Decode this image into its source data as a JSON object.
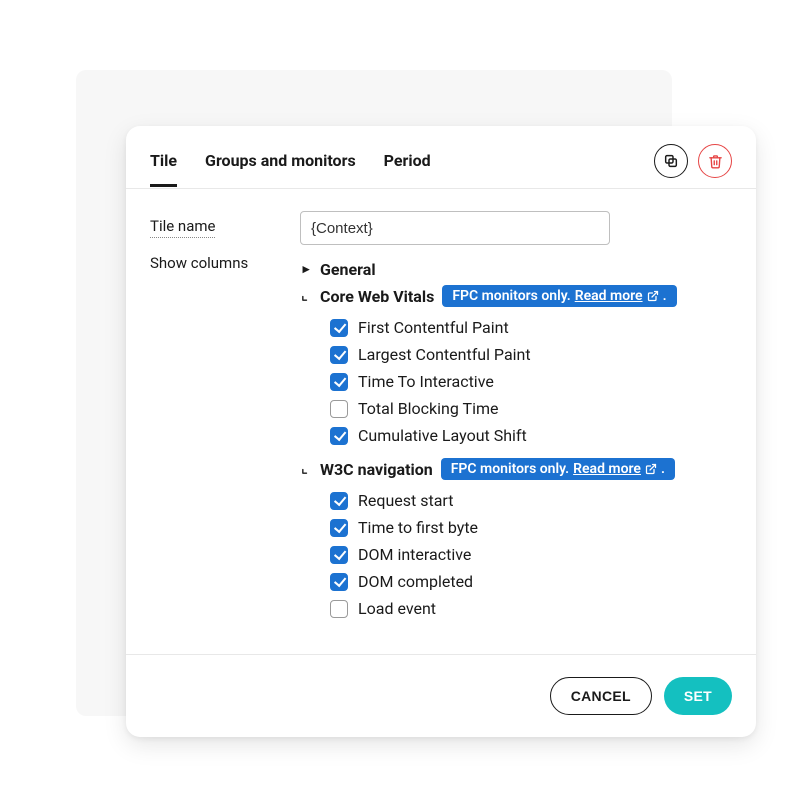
{
  "tabs": {
    "items": [
      {
        "label": "Tile",
        "active": true
      },
      {
        "label": "Groups and monitors",
        "active": false
      },
      {
        "label": "Period",
        "active": false
      }
    ]
  },
  "labels": {
    "tile_name": "Tile name",
    "show_columns": "Show columns"
  },
  "tile_name_input": {
    "value": "{Context}"
  },
  "groups": [
    {
      "key": "general",
      "name": "General",
      "expanded": false,
      "badge": null,
      "options": []
    },
    {
      "key": "core_web_vitals",
      "name": "Core Web Vitals",
      "expanded": true,
      "badge": {
        "text": "FPC monitors only.",
        "link_text": "Read more"
      },
      "options": [
        {
          "label": "First Contentful Paint",
          "checked": true
        },
        {
          "label": "Largest Contentful Paint",
          "checked": true
        },
        {
          "label": "Time To Interactive",
          "checked": true
        },
        {
          "label": "Total Blocking Time",
          "checked": false
        },
        {
          "label": "Cumulative Layout Shift",
          "checked": true
        }
      ]
    },
    {
      "key": "w3c_navigation",
      "name": "W3C navigation",
      "expanded": true,
      "badge": {
        "text": "FPC monitors only.",
        "link_text": "Read more"
      },
      "options": [
        {
          "label": "Request start",
          "checked": true
        },
        {
          "label": "Time to first byte",
          "checked": true
        },
        {
          "label": "DOM interactive",
          "checked": true
        },
        {
          "label": "DOM completed",
          "checked": true
        },
        {
          "label": "Load event",
          "checked": false
        }
      ]
    }
  ],
  "footer": {
    "cancel": "CANCEL",
    "set": "SET"
  }
}
